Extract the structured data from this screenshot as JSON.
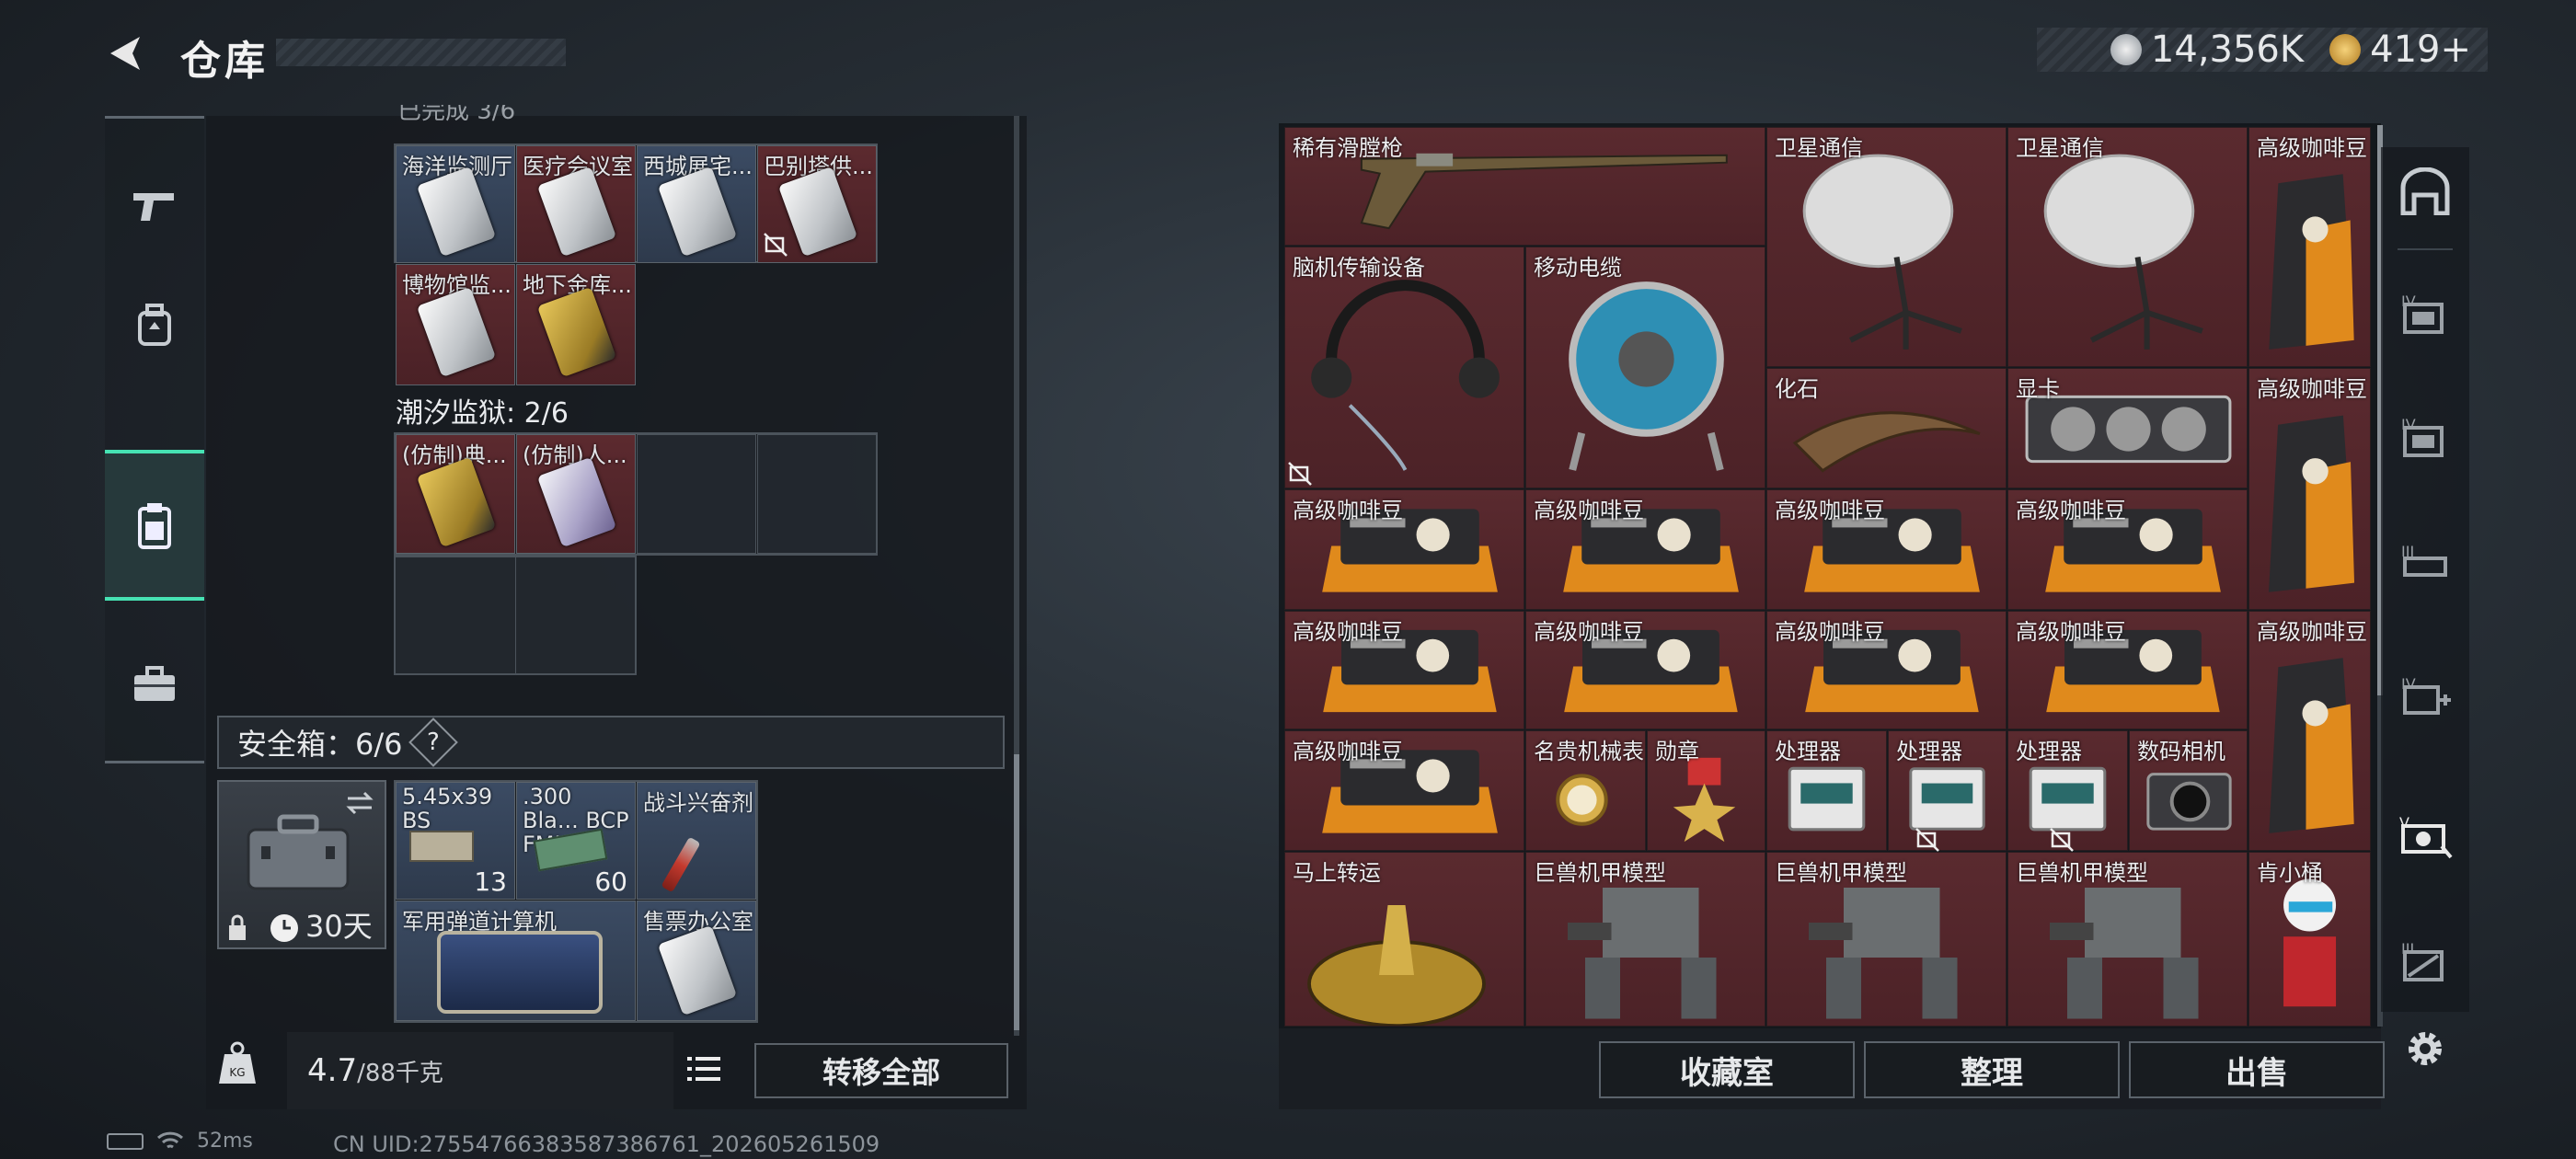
{
  "header": {
    "title": "仓库",
    "currency1": "14,356K",
    "currency2": "419+",
    "note": ""
  },
  "left_nav": [
    "pistol-icon",
    "backpack-icon",
    "case-icon",
    "toolbox-icon"
  ],
  "left": {
    "top_cut": "已完成 3/6",
    "row1": [
      "海洋监测厅",
      "医疗会议室",
      "西城展宅...",
      "巴别塔供..."
    ],
    "row2": [
      "博物馆监...",
      "地下金库..."
    ],
    "prison_title": "潮汐监狱: 2/6",
    "prison": [
      "(仿制)典...",
      "(仿制)人..."
    ],
    "safe_title": "安全箱：6/6",
    "safe_help": "?",
    "safe_time": "30天",
    "safe_items": [
      {
        "label": "5.45x39 BS",
        "count": "13"
      },
      {
        "label": ".300 Bla... BCP FMJ",
        "count": "60"
      },
      {
        "label": "战斗兴奋剂",
        "count": ""
      },
      {
        "label": "军用弹道计算机",
        "count": ""
      },
      {
        "label": "售票办公室",
        "count": ""
      }
    ],
    "weight_value": "4.7",
    "weight_max": "/88千克",
    "weight_icon": "KG",
    "transfer_all": "转移全部"
  },
  "right": {
    "items": [
      "稀有滑膛枪",
      "卫星通信",
      "卫星通信",
      "高级咖啡豆",
      "脑机传输设备",
      "移动电缆",
      "化石",
      "显卡",
      "高级咖啡豆",
      "高级咖啡豆",
      "高级咖啡豆",
      "高级咖啡豆",
      "高级咖啡豆",
      "高级咖啡豆",
      "高级咖啡豆",
      "高级咖啡豆",
      "高级咖啡豆",
      "高级咖啡豆",
      "高级咖啡豆",
      "名贵机械表",
      "勋章",
      "处理器",
      "处理器",
      "处理器",
      "数码相机",
      "马上转运",
      "巨兽机甲模型",
      "巨兽机甲模型",
      "巨兽机甲模型",
      "肯小桶"
    ],
    "buttons": [
      "收藏室",
      "整理",
      "出售"
    ]
  },
  "right_nav": [
    "base-icon",
    "storage-4-icon",
    "storage-4b-icon",
    "storage-3-icon",
    "medkit-4-icon",
    "lab-item-icon",
    "storage-3b-icon",
    "settings-icon"
  ],
  "status": {
    "ping": "52ms",
    "uid": "CN UID:27554766383587386761_202605261509"
  },
  "colors": {
    "accent": "#46e2b3",
    "slot_red": "#5a2a2f",
    "slot_blue": "#3b4b63"
  }
}
